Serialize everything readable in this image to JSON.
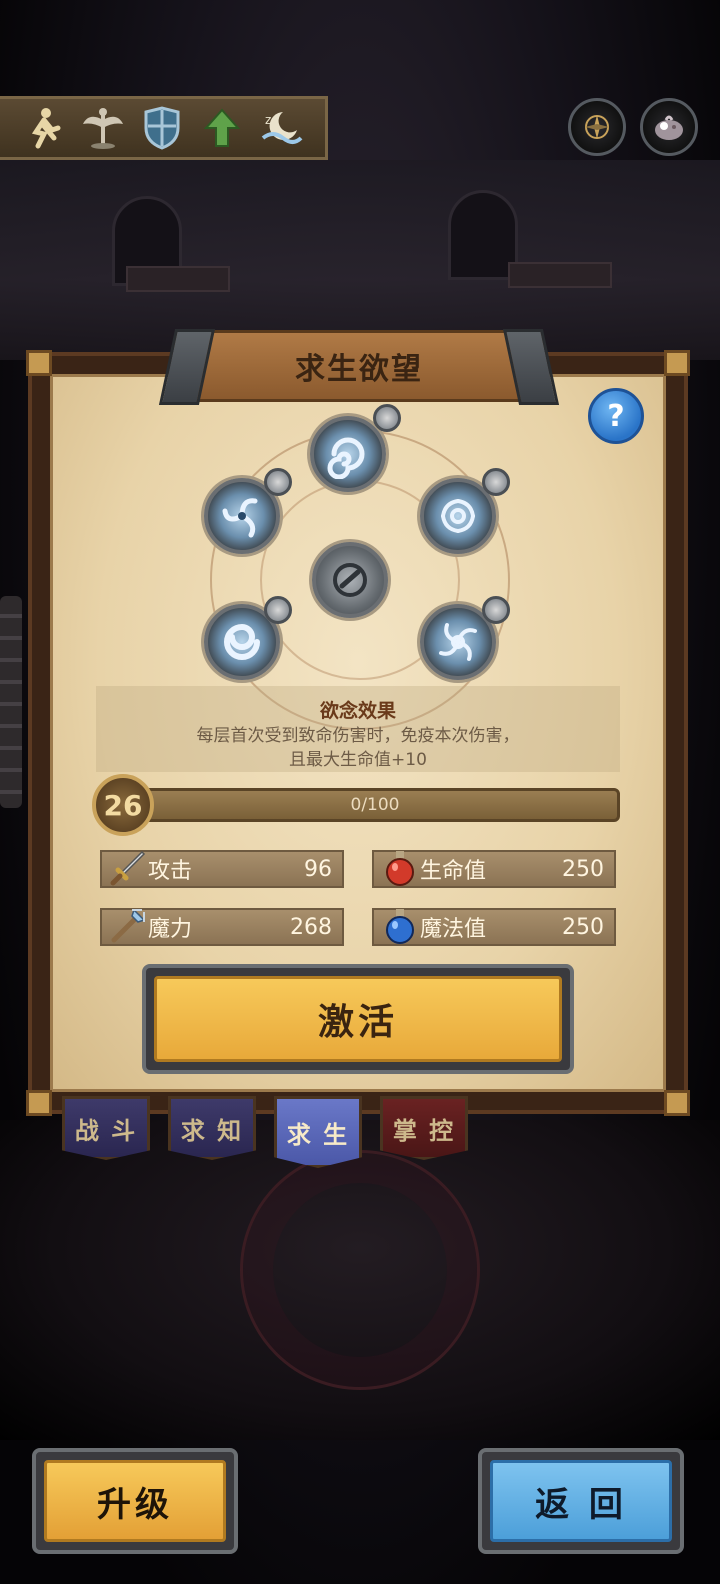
{
  "topbar": {
    "icons": [
      "running-figure-icon",
      "winged-staff-icon",
      "shield-icon",
      "up-arrow-icon",
      "moon-sleep-icon"
    ],
    "right_buttons": [
      "compass-icon",
      "pouch-icon"
    ]
  },
  "panel": {
    "title": "求生欲望",
    "help_label": "?",
    "effect_title": "欲念效果",
    "effect_desc_line1": "每层首次受到致命伤害时，免疫本次伤害，",
    "effect_desc_line2": "且最大生命值+10",
    "level": "26",
    "progress_text": "0/100",
    "progress_value": 0,
    "progress_max": 100,
    "stats": [
      {
        "label": "攻击",
        "value": "96",
        "icon": "sword-icon"
      },
      {
        "label": "生命值",
        "value": "250",
        "icon": "red-potion-icon"
      },
      {
        "label": "魔力",
        "value": "268",
        "icon": "staff-icon"
      },
      {
        "label": "魔法值",
        "value": "250",
        "icon": "blue-potion-icon"
      }
    ],
    "activate_label": "激活"
  },
  "tabs": [
    {
      "label": "战 斗",
      "selected": false
    },
    {
      "label": "求 知",
      "selected": false
    },
    {
      "label": "求 生",
      "selected": true
    },
    {
      "label": "掌 控",
      "selected": false
    }
  ],
  "bottom": {
    "upgrade_label": "升级",
    "back_label": "返 回"
  },
  "colors": {
    "gold_button": "#f0b845",
    "blue_button": "#62b2e6",
    "parchment": "#ead6ac",
    "selected_tab": "#5a68b8"
  }
}
